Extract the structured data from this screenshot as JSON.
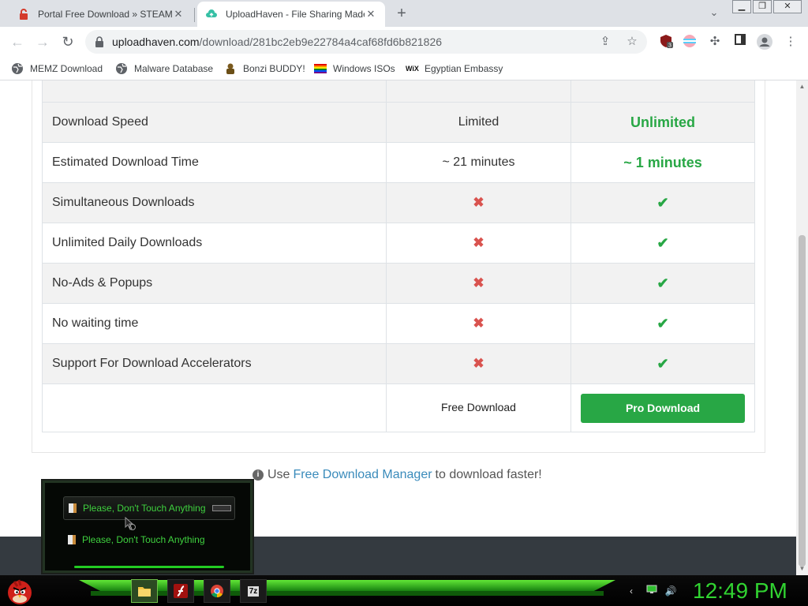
{
  "browser": {
    "tabs": [
      {
        "title": "Portal Free Download » STEAMUNLOCKED",
        "active": false
      },
      {
        "title": "UploadHaven - File Sharing Made Simple",
        "active": true
      }
    ],
    "new_tab": "+",
    "address": {
      "host": "uploadhaven.com",
      "path": "/download/281bc2eb9e22784a4caf68fd6b821826"
    },
    "extension_badge": "3",
    "bookmarks": [
      {
        "label": "MEMZ Download",
        "icon": "globe-icon"
      },
      {
        "label": "Malware Database",
        "icon": "globe-icon"
      },
      {
        "label": "Bonzi BUDDY!",
        "icon": "bonzi-icon"
      },
      {
        "label": "Windows ISOs",
        "icon": "rainbow-flag-icon"
      },
      {
        "label": "Egyptian Embassy",
        "icon": "wix-icon"
      }
    ]
  },
  "comparison": {
    "rows": [
      {
        "feature": "Download Speed",
        "free": "Limited",
        "pro": "Unlimited"
      },
      {
        "feature": "Estimated Download Time",
        "free": "~ 21 minutes",
        "pro": "~ 1 minutes"
      },
      {
        "feature": "Simultaneous Downloads",
        "free": "✖",
        "pro": "✔"
      },
      {
        "feature": "Unlimited Daily Downloads",
        "free": "✖",
        "pro": "✔"
      },
      {
        "feature": "No-Ads & Popups",
        "free": "✖",
        "pro": "✔"
      },
      {
        "feature": "No waiting time",
        "free": "✖",
        "pro": "✔"
      },
      {
        "feature": "Support For Download Accelerators",
        "free": "✖",
        "pro": "✔"
      }
    ],
    "free_download": "Free Download",
    "pro_download": "Pro Download"
  },
  "fdm": {
    "prefix": "Use",
    "link": "Free Download Manager",
    "suffix": "to download faster!"
  },
  "overlay": {
    "items": [
      "Please, Don't Touch Anything",
      "Please, Don't Touch Anything"
    ]
  },
  "taskbar": {
    "clock": "12:49 PM",
    "apps": [
      "file-explorer-icon",
      "flash-player-icon",
      "chrome-icon",
      "7zip-icon"
    ],
    "sevenzip_label": "7z"
  },
  "colors": {
    "pro_green": "#28a745",
    "cross_red": "#d9534f",
    "link_blue": "#3a8bbb",
    "clock_green": "#31d331"
  }
}
